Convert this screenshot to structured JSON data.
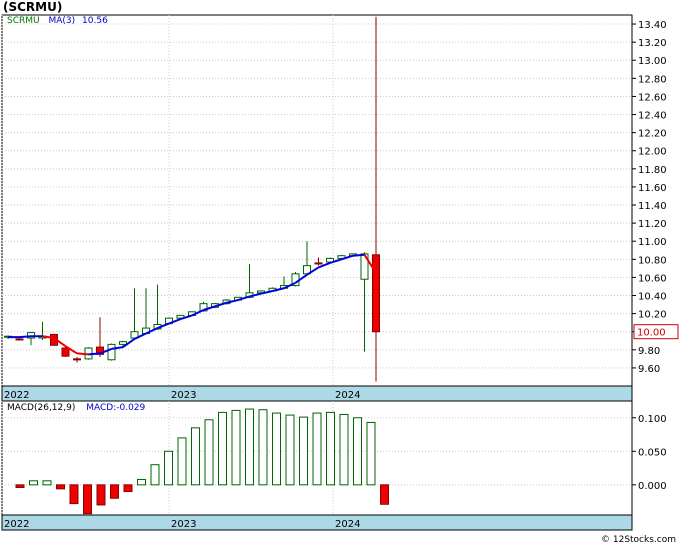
{
  "title": "(SCRMU)",
  "legend": {
    "symbol": "SCRMU",
    "ma_label": "MA(3)",
    "ma_value": "10.56"
  },
  "macd_legend": {
    "label": "MACD(26,12,9)",
    "value_label": "MACD:-0.029"
  },
  "watermark": "© 12Stocks.com",
  "last_price_label": "10.00",
  "chart_data": [
    {
      "type": "candlestick",
      "series_name": "SCRMU",
      "x_labels": [
        "2022",
        "2023",
        "2024"
      ],
      "y_ticks": [
        9.6,
        9.8,
        10.0,
        10.2,
        10.4,
        10.6,
        10.8,
        11.0,
        11.2,
        11.4,
        11.6,
        11.8,
        12.0,
        12.2,
        12.4,
        12.6,
        12.8,
        13.0,
        13.2,
        13.4
      ],
      "ylim": [
        9.4,
        13.5
      ],
      "last_price": 10.0,
      "ma_label": "MA(3)",
      "ma_value": 10.56,
      "candles": [
        {
          "o": 9.94,
          "h": 9.96,
          "l": 9.92,
          "c": 9.95,
          "up": true
        },
        {
          "o": 9.92,
          "h": 9.93,
          "l": 9.91,
          "c": 9.92,
          "up": false
        },
        {
          "o": 9.93,
          "h": 10.0,
          "l": 9.85,
          "c": 9.99,
          "up": true
        },
        {
          "o": 9.93,
          "h": 10.11,
          "l": 9.91,
          "c": 9.95,
          "up": true
        },
        {
          "o": 9.97,
          "h": 9.97,
          "l": 9.85,
          "c": 9.85,
          "up": false
        },
        {
          "o": 9.82,
          "h": 9.83,
          "l": 9.72,
          "c": 9.73,
          "up": false
        },
        {
          "o": 9.7,
          "h": 9.72,
          "l": 9.66,
          "c": 9.7,
          "up": false
        },
        {
          "o": 9.7,
          "h": 9.83,
          "l": 9.69,
          "c": 9.82,
          "up": true
        },
        {
          "o": 9.83,
          "h": 10.16,
          "l": 9.72,
          "c": 9.75,
          "up": false
        },
        {
          "o": 9.69,
          "h": 9.87,
          "l": 9.68,
          "c": 9.86,
          "up": true
        },
        {
          "o": 9.86,
          "h": 9.9,
          "l": 9.82,
          "c": 9.89,
          "up": true
        },
        {
          "o": 9.93,
          "h": 10.48,
          "l": 9.92,
          "c": 10.0,
          "up": true
        },
        {
          "o": 9.98,
          "h": 10.48,
          "l": 9.97,
          "c": 10.04,
          "up": true
        },
        {
          "o": 10.03,
          "h": 10.52,
          "l": 10.02,
          "c": 10.08,
          "up": true
        },
        {
          "o": 10.09,
          "h": 10.16,
          "l": 10.08,
          "c": 10.15,
          "up": true
        },
        {
          "o": 10.15,
          "h": 10.18,
          "l": 10.14,
          "c": 10.18,
          "up": true
        },
        {
          "o": 10.18,
          "h": 10.22,
          "l": 10.17,
          "c": 10.22,
          "up": true
        },
        {
          "o": 10.23,
          "h": 10.33,
          "l": 10.22,
          "c": 10.31,
          "up": true
        },
        {
          "o": 10.27,
          "h": 10.32,
          "l": 10.26,
          "c": 10.31,
          "up": true
        },
        {
          "o": 10.31,
          "h": 10.36,
          "l": 10.3,
          "c": 10.35,
          "up": true
        },
        {
          "o": 10.35,
          "h": 10.38,
          "l": 10.34,
          "c": 10.38,
          "up": true
        },
        {
          "o": 10.38,
          "h": 10.75,
          "l": 10.37,
          "c": 10.43,
          "up": true
        },
        {
          "o": 10.43,
          "h": 10.46,
          "l": 10.42,
          "c": 10.45,
          "up": true
        },
        {
          "o": 10.45,
          "h": 10.49,
          "l": 10.44,
          "c": 10.48,
          "up": true
        },
        {
          "o": 10.48,
          "h": 10.61,
          "l": 10.47,
          "c": 10.51,
          "up": true
        },
        {
          "o": 10.51,
          "h": 10.66,
          "l": 10.5,
          "c": 10.64,
          "up": true
        },
        {
          "o": 10.64,
          "h": 11.0,
          "l": 10.63,
          "c": 10.73,
          "up": true
        },
        {
          "o": 10.76,
          "h": 10.82,
          "l": 10.73,
          "c": 10.75,
          "up": false
        },
        {
          "o": 10.77,
          "h": 10.82,
          "l": 10.76,
          "c": 10.81,
          "up": true
        },
        {
          "o": 10.81,
          "h": 10.85,
          "l": 10.8,
          "c": 10.84,
          "up": true
        },
        {
          "o": 10.84,
          "h": 10.86,
          "l": 10.83,
          "c": 10.86,
          "up": true
        },
        {
          "o": 10.58,
          "h": 10.88,
          "l": 9.78,
          "c": 10.86,
          "up": true
        },
        {
          "o": 10.85,
          "h": 13.48,
          "l": 9.45,
          "c": 10.0,
          "up": false
        }
      ],
      "ma3": [
        9.94,
        9.94,
        9.95,
        9.95,
        9.93,
        9.84,
        9.76,
        9.75,
        9.76,
        9.81,
        9.83,
        9.92,
        9.98,
        10.04,
        10.09,
        10.14,
        10.18,
        10.24,
        10.28,
        10.32,
        10.35,
        10.39,
        10.42,
        10.45,
        10.48,
        10.54,
        10.63,
        10.71,
        10.76,
        10.8,
        10.84,
        10.85,
        10.65
      ]
    },
    {
      "type": "bar",
      "series_name": "MACD(26,12,9)",
      "value_label": "MACD:-0.029",
      "y_ticks": [
        0.0,
        0.05,
        0.1
      ],
      "ylim": [
        -0.045,
        0.125
      ],
      "x_labels": [
        "2022",
        "2023",
        "2024"
      ],
      "values": [
        -0.004,
        0.006,
        0.006,
        -0.006,
        -0.028,
        -0.043,
        -0.03,
        -0.02,
        -0.01,
        0.008,
        0.03,
        0.05,
        0.07,
        0.085,
        0.097,
        0.108,
        0.111,
        0.113,
        0.112,
        0.107,
        0.104,
        0.101,
        0.107,
        0.108,
        0.105,
        0.1,
        0.093,
        -0.029
      ]
    }
  ]
}
